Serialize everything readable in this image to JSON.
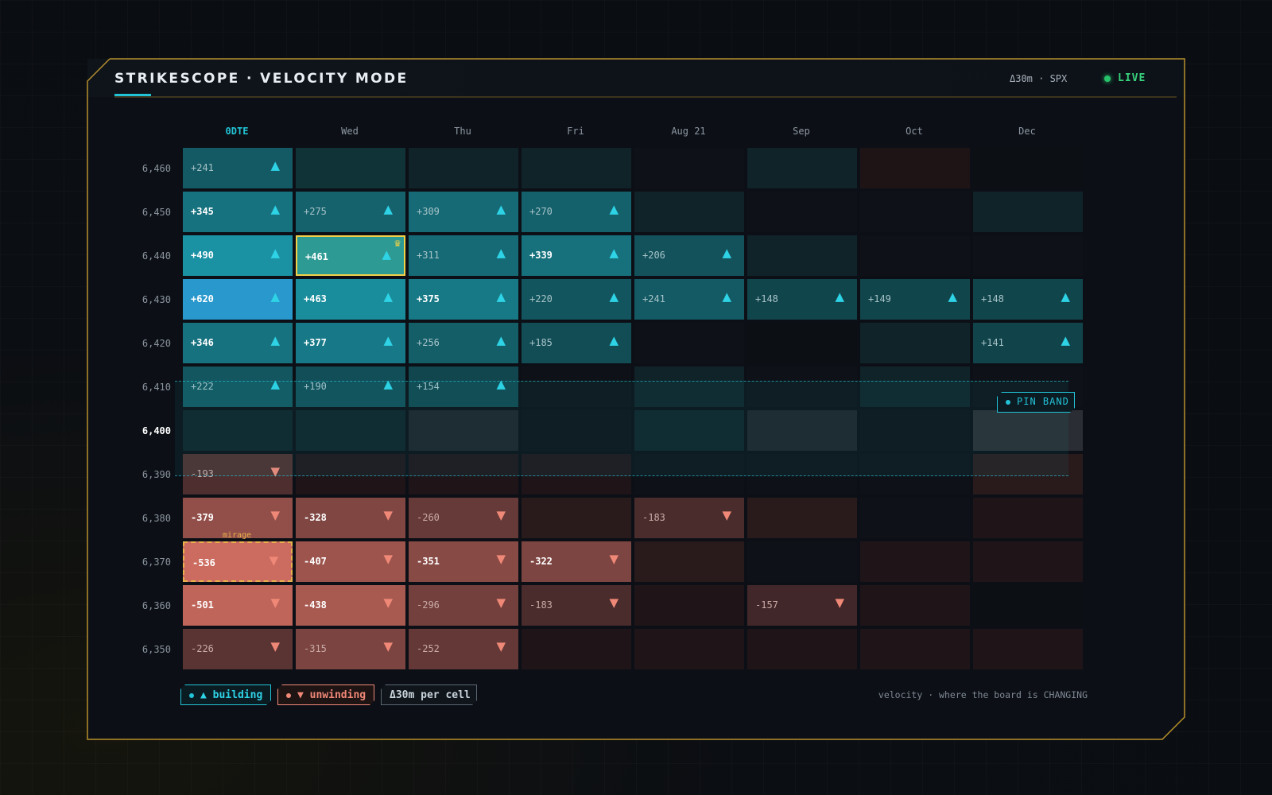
{
  "header": {
    "title": "STRIKESCOPE · VELOCITY MODE",
    "meta": "Δ30m · SPX",
    "live": "LIVE"
  },
  "colors": {
    "accent": "#22c3d6",
    "building": "#2ed3e6",
    "unwinding": "#f08877",
    "highlight": "#f2d147",
    "mirage": "#e8b04a",
    "live": "#37d27d",
    "frame": "#b8902c"
  },
  "columns": [
    "0DTE",
    "Wed",
    "Thu",
    "Fri",
    "Aug 21",
    "Sep",
    "Oct",
    "Dec"
  ],
  "active_column": 0,
  "rows": [
    "6,460",
    "6,450",
    "6,440",
    "6,430",
    "6,420",
    "6,410",
    "6,400",
    "6,390",
    "6,380",
    "6,370",
    "6,360",
    "6,350"
  ],
  "current_row": 6,
  "cells": [
    [
      "+241",
      null,
      null,
      null,
      null,
      null,
      null,
      null
    ],
    [
      "+345",
      "+275",
      "+309",
      "+270",
      null,
      null,
      null,
      null
    ],
    [
      "+490",
      "+461",
      "+311",
      "+339",
      "+206",
      null,
      null,
      null
    ],
    [
      "+620",
      "+463",
      "+375",
      "+220",
      "+241",
      "+148",
      "+149",
      "+148"
    ],
    [
      "+346",
      "+377",
      "+256",
      "+185",
      null,
      null,
      null,
      "+141"
    ],
    [
      "+222",
      "+190",
      "+154",
      null,
      null,
      null,
      null,
      null
    ],
    [
      null,
      null,
      null,
      null,
      null,
      null,
      null,
      null
    ],
    [
      "-193",
      null,
      null,
      null,
      null,
      null,
      null,
      null
    ],
    [
      "-379",
      "-328",
      "-260",
      null,
      "-183",
      null,
      null,
      null
    ],
    [
      "-536",
      "-407",
      "-351",
      "-322",
      null,
      null,
      null,
      null
    ],
    [
      "-501",
      "-438",
      "-296",
      "-183",
      null,
      "-157",
      null,
      null
    ],
    [
      "-226",
      "-315",
      "-252",
      null,
      null,
      null,
      null,
      null
    ]
  ],
  "empty_cell_tones": [
    [
      null,
      "tealdim",
      "teal0",
      "teal0",
      "dark",
      "teal0",
      "reddark",
      "darker"
    ],
    [
      null,
      null,
      null,
      null,
      "teal0",
      "dark",
      "dark",
      "teal0"
    ],
    [
      null,
      null,
      null,
      null,
      null,
      "teal0",
      "dark",
      "dark"
    ],
    [
      null,
      null,
      null,
      null,
      null,
      null,
      null,
      null
    ],
    [
      null,
      null,
      null,
      null,
      "dark",
      "darker",
      "teal0",
      null
    ],
    [
      null,
      null,
      null,
      "dark",
      "teal0",
      "dark",
      "teal0",
      "dark"
    ],
    [
      "teal0",
      "teal0",
      "gray",
      "dark",
      "teal0",
      "gray",
      "dark",
      "gray2"
    ],
    [
      null,
      "red0",
      "red0",
      "red0",
      "dark",
      "dark",
      "dark",
      "red1"
    ],
    [
      null,
      null,
      null,
      "red1",
      null,
      "red1",
      "dark",
      "red0"
    ],
    [
      null,
      null,
      null,
      null,
      "red1",
      "dark",
      "red0",
      "red0"
    ],
    [
      null,
      null,
      null,
      null,
      "red0",
      null,
      "red0",
      "darker"
    ],
    [
      null,
      null,
      null,
      "red0",
      "red0",
      "red0",
      "red0",
      "red0"
    ]
  ],
  "highlight_cell": {
    "row": 2,
    "col": 1
  },
  "mirage_cell": {
    "row": 9,
    "col": 0,
    "label": "mirage"
  },
  "pin_band": {
    "label": "PIN BAND",
    "from": "6,410",
    "to": "6,390"
  },
  "legend": {
    "building": "building",
    "unwinding": "unwinding",
    "per_cell": "Δ30m per cell"
  },
  "footnote": "velocity · where the board is CHANGING",
  "icons": {
    "up": "triangle-up-icon",
    "down": "triangle-down-icon",
    "crown": "crown-icon"
  }
}
